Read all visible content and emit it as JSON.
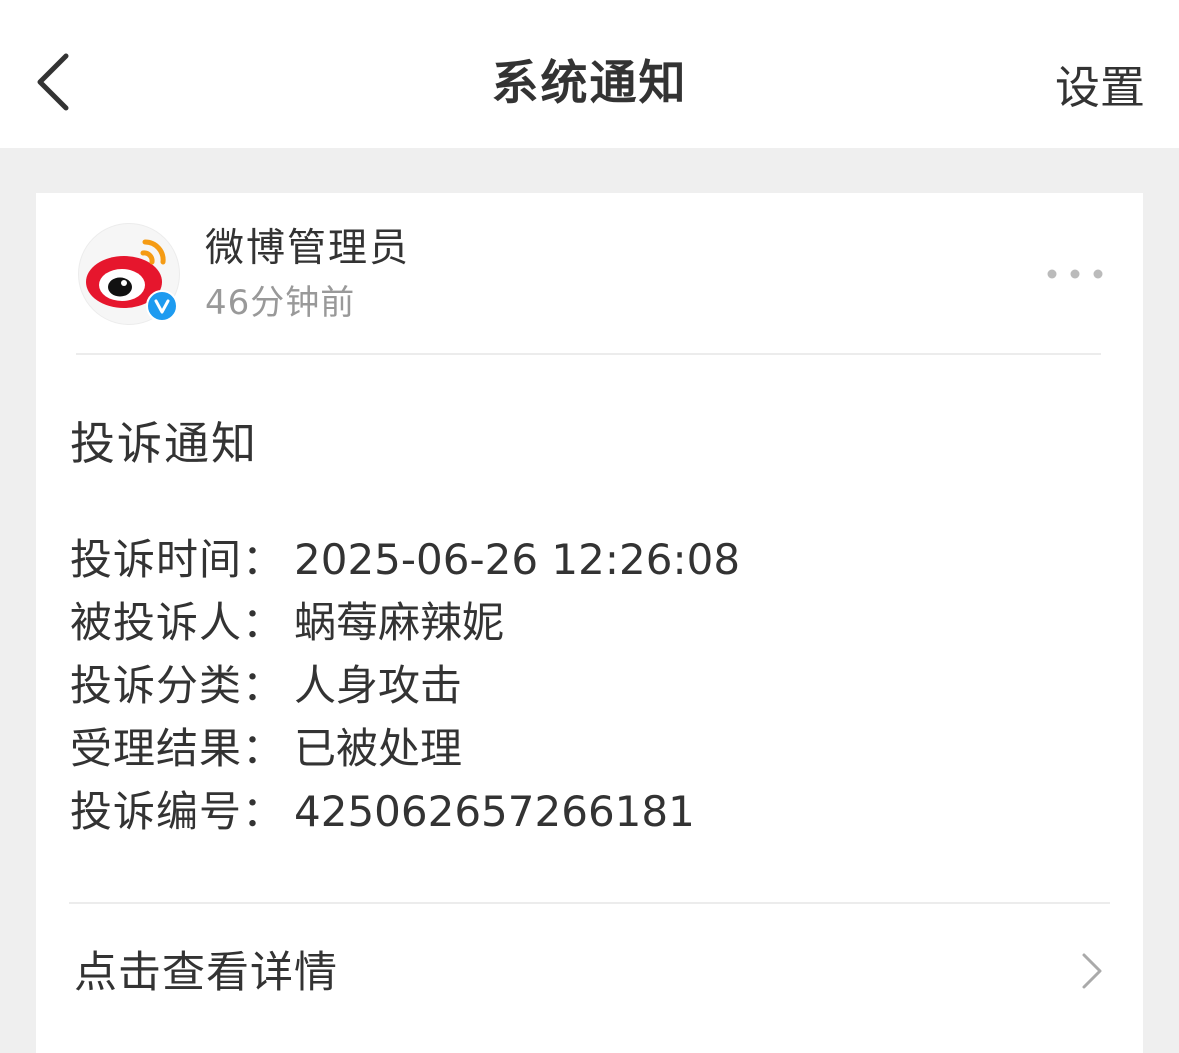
{
  "nav": {
    "title": "系统通知",
    "settings_label": "设置",
    "back_icon": "chevron-left-icon"
  },
  "message": {
    "sender": {
      "name": "微博管理员",
      "time": "46分钟前",
      "avatar_icon": "weibo-logo",
      "verified_icon": "verified-v-icon"
    },
    "more_icon": "more-dots-icon",
    "heading": "投诉通知",
    "details": [
      {
        "label": "投诉时间：",
        "value": "2025-06-26 12:26:08"
      },
      {
        "label": "被投诉人：",
        "value": "蜗莓麻辣妮"
      },
      {
        "label": "投诉分类：",
        "value": "人身攻击"
      },
      {
        "label": "受理结果：",
        "value": "已被处理"
      },
      {
        "label": "投诉编号：",
        "value": "425062657266181"
      }
    ],
    "view_detail_label": "点击查看详情",
    "view_detail_icon": "chevron-right-icon"
  },
  "colors": {
    "background": "#efefef",
    "card": "#ffffff",
    "text_primary": "#333333",
    "text_secondary": "#999999",
    "verified_blue": "#1e9bf0",
    "weibo_red": "#e6162d",
    "weibo_orange": "#f59b14"
  }
}
